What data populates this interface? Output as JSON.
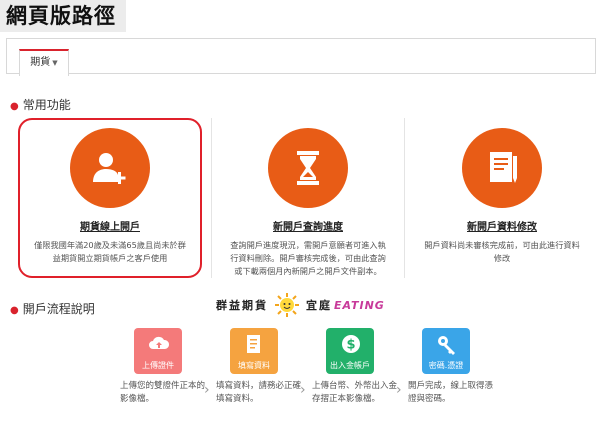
{
  "header": {
    "title": "網頁版路徑"
  },
  "tabs": [
    {
      "label": "期貨",
      "caret": "▼"
    }
  ],
  "sections": {
    "common": "常用功能",
    "process": "開戶流程說明"
  },
  "features": [
    {
      "title": "期貨線上開戶",
      "desc": "僅限我國年滿20歲及未滿65歲且尚未於群益期貨開立期貨帳戶之客戶使用",
      "icon": "add-user-icon"
    },
    {
      "title": "新開戶查詢進度",
      "desc": "查詢開戶進度現況，需開戶意願者可進入執行資料刪除。開戶審核完成後，可由此查詢或下載兩個月內新開戶之開戶文件副本。",
      "icon": "hourglass-icon"
    },
    {
      "title": "新開戶資料修改",
      "desc": "開戶資料尚未審核完成前，可由此進行資料修改",
      "icon": "document-edit-icon"
    }
  ],
  "banner": {
    "text": "群益期貨",
    "text2": "宜庭",
    "eating": "EATING"
  },
  "steps": [
    {
      "label": "上傳證件",
      "desc": "上傳您的雙證件正本的影像檔。",
      "color": "#f47a7a",
      "icon": "cloud-upload-icon"
    },
    {
      "label": "填寫資料",
      "desc": "填寫資料，請務必正確填寫資料。",
      "color": "#f5a340",
      "icon": "form-icon"
    },
    {
      "label": "出入金帳戶",
      "desc": "上傳台幣、外幣出入金存摺正本影像檔。",
      "color": "#22b06a",
      "icon": "dollar-icon"
    },
    {
      "label": "密碼.憑證",
      "desc": "開戶完成，線上取得憑證與密碼。",
      "color": "#3aa5e8",
      "icon": "key-icon"
    }
  ],
  "colors": {
    "accent": "#d9232d",
    "feature_circle": "#e85c16"
  }
}
